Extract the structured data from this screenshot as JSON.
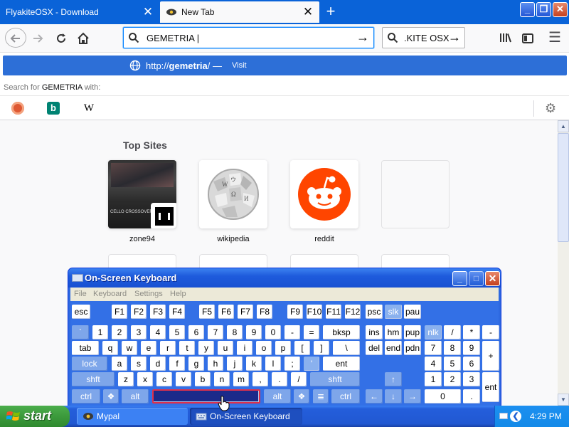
{
  "browser": {
    "tabs": [
      {
        "title": "FlyakiteOSX - Download",
        "active": false
      },
      {
        "title": "New Tab",
        "active": true
      }
    ],
    "new_tab_label": "+",
    "window_controls": {
      "minimize": "_",
      "maximize": "❐",
      "close": "✕"
    }
  },
  "navbar": {
    "url_value": "GEMETRIA |",
    "search_value": ".KITE OSX",
    "menu_glyph": "☰"
  },
  "url_dropdown": {
    "suggestion_url_prefix": "http://",
    "suggestion_url_bold": "gemetria",
    "suggestion_url_suffix": "/",
    "suggestion_separator": " — ",
    "suggestion_action": "Visit",
    "search_for_prefix": "Search for ",
    "search_for_query": "GEMETRIA",
    "search_for_suffix": " with:",
    "engines": [
      "duckduckgo-icon",
      "bing-icon",
      "wikipedia-icon"
    ]
  },
  "newtab": {
    "top_sites_title": "Top Sites",
    "sites": [
      {
        "label": "zone94",
        "caption": "CELLO CROSSOVER MU METAL"
      },
      {
        "label": "wikipedia"
      },
      {
        "label": "reddit"
      },
      {
        "label": ""
      }
    ]
  },
  "osk": {
    "title": "On-Screen Keyboard",
    "menu": [
      "File",
      "Keyboard",
      "Settings",
      "Help"
    ],
    "window_controls": {
      "minimize": "_",
      "maximize": "□",
      "close": "✕"
    }
  },
  "taskbar": {
    "start_label": "start",
    "items": [
      {
        "label": "Mypal",
        "active": false
      },
      {
        "label": "On-Screen Keyboard",
        "active": true
      }
    ],
    "clock": "4:29 PM"
  }
}
